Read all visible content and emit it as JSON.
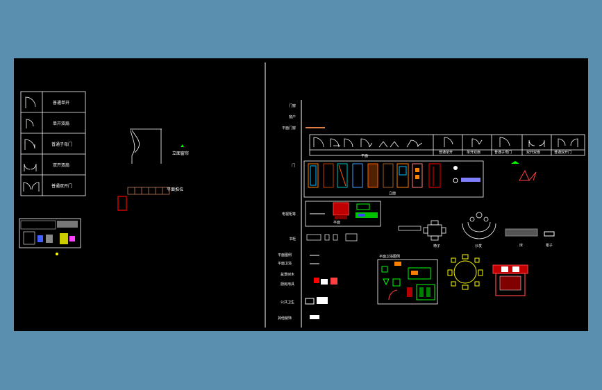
{
  "left_panel": {
    "door_legend": [
      "普通单开",
      "单开双扇",
      "普通子母门",
      "双开双扇",
      "普通双开门"
    ],
    "curtain_label": "立面窗帘",
    "sliding_label": "平面推拉"
  },
  "right_panel": {
    "row_labels": [
      "门窗",
      "窗户",
      "平面门窗",
      "门",
      "电视柜等",
      "书柜",
      "平面图例",
      "平面卫浴",
      "盆景树木",
      "厨房用具",
      "公共卫生",
      "其他装饰"
    ],
    "door_table_labels": [
      "普通单开",
      "单开双扇",
      "普通子母门",
      "双开双扇",
      "普通双开门"
    ],
    "sub_labels": {
      "doors_caption": "平面",
      "door_elev_caption": "立面",
      "tv_caption": "平面",
      "furniture_a": "椅子",
      "furniture_b": "沙发",
      "furniture_c": "床",
      "furniture_d": "柜子",
      "bath_title": "平面卫浴图例"
    }
  },
  "colors": {
    "background": "#5a8fb0",
    "canvas": "#000000",
    "line": "#ffffff",
    "accent_yellow": "#ffff00",
    "accent_red": "#ff0000",
    "accent_cyan": "#00ffff",
    "accent_green": "#00ff00"
  }
}
